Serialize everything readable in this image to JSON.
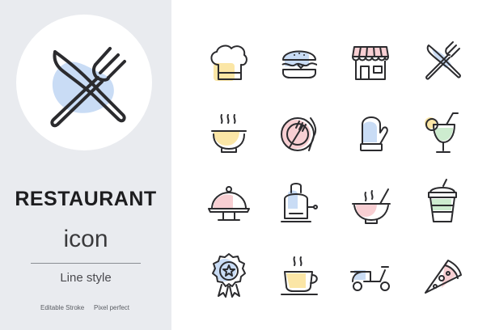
{
  "header": {
    "title": "RESTAURANT",
    "subtitle": "icon",
    "style_label": "Line style"
  },
  "footer": {
    "left_note": "Editable Stroke",
    "right_note": "Pixel perfect"
  },
  "colors": {
    "sidebar_bg": "#e9ebef",
    "stroke": "#2b2b2e",
    "accent_blue": "#c9dcf5",
    "accent_pink": "#f8cfd3",
    "accent_yellow": "#fbe6a6",
    "accent_green": "#cdeccf"
  },
  "hero_icon": "fork-and-knife-icon",
  "icons": [
    "chef-hat-icon",
    "burger-icon",
    "shop-icon",
    "fork-knife-icon",
    "soup-bowl-icon",
    "plate-cutlery-icon",
    "oven-mitt-icon",
    "cocktail-icon",
    "cloche-icon",
    "toaster-icon",
    "hot-bowl-icon",
    "takeaway-cup-icon",
    "badge-star-icon",
    "coffee-cup-icon",
    "scooter-icon",
    "pizza-slice-icon"
  ]
}
